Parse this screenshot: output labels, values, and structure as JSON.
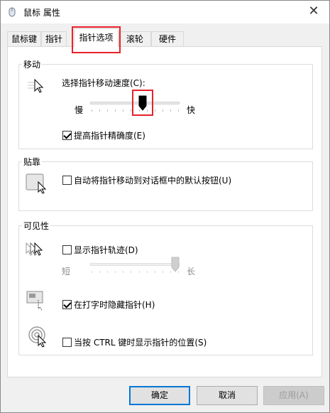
{
  "window": {
    "title": "鼠标 属性",
    "close_glyph": "✕"
  },
  "tabs": [
    {
      "label": "鼠标键"
    },
    {
      "label": "指针"
    },
    {
      "label": "指针选项"
    },
    {
      "label": "滚轮"
    },
    {
      "label": "硬件"
    }
  ],
  "active_tab": "指针选项",
  "motion": {
    "title": "移动",
    "speed_label": "选择指针移动速度(C):",
    "slow_label": "慢",
    "fast_label": "快",
    "speed_level": 0.6,
    "precision_label": "提高指针精确度(E)",
    "precision_checked": true
  },
  "snap": {
    "title": "贴靠",
    "snap_label": "自动将指针移动到对话框中的默认按钮(U)",
    "snap_checked": false
  },
  "visibility": {
    "title": "可见性",
    "trails_label": "显示指针轨迹(D)",
    "trails_checked": false,
    "short_label": "短",
    "long_label": "长",
    "trails_level": 1.0,
    "hide_typing_label": "在打字时隐藏指针(H)",
    "hide_typing_checked": true,
    "ctrl_label": "当按 CTRL 键时显示指针的位置(S)",
    "ctrl_checked": false
  },
  "buttons": {
    "ok": "确定",
    "cancel": "取消",
    "apply": "应用(A)"
  },
  "colors": {
    "highlight": "#e8212b",
    "accent": "#0078d7"
  }
}
